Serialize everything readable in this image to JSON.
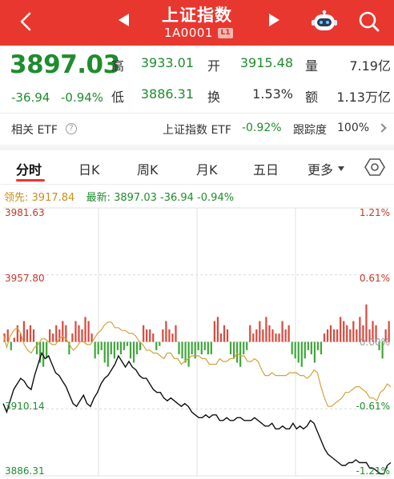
{
  "header": {
    "title": "上证指数",
    "code": "1A0001",
    "level_badge": "L1"
  },
  "quote": {
    "price": "3897.03",
    "change": "-36.94",
    "change_pct": "-0.94%",
    "high_label": "高",
    "high": "3933.01",
    "low_label": "低",
    "low": "3886.31",
    "open_label": "开",
    "open": "3915.48",
    "turnover_label": "换",
    "turnover": "1.53%",
    "volume_label": "量",
    "volume": "7.19亿",
    "amount_label": "额",
    "amount": "1.13万亿"
  },
  "etf": {
    "label": "相关 ETF",
    "name": "上证指数 ETF",
    "change": "-0.92%",
    "tracking_label": "跟踪度",
    "tracking": "100%"
  },
  "tabs": [
    "分时",
    "日K",
    "周K",
    "月K",
    "五日",
    "更多"
  ],
  "legend": {
    "lead_label": "领先:",
    "lead_value": "3917.84",
    "latest_label": "最新:",
    "latest_value": "3897.03",
    "latest_change": "-36.94",
    "latest_pct": "-0.94%"
  },
  "chart_data": {
    "type": "line",
    "left_axis": [
      "3981.63",
      "3957.80",
      "3910.14",
      "3886.31"
    ],
    "right_axis": [
      "1.21%",
      "0.61%",
      "-0.61%",
      "-1.21%"
    ],
    "center_label": "0.00%",
    "ylim": [
      3886.31,
      3981.63
    ],
    "series": [
      {
        "color": "#111111",
        "values": [
          3912,
          3909,
          3913,
          3917,
          3919,
          3921,
          3920,
          3918,
          3917,
          3922,
          3926,
          3930,
          3928,
          3929,
          3926,
          3923,
          3922,
          3920,
          3918,
          3915,
          3912,
          3911,
          3913,
          3915,
          3912,
          3911,
          3914,
          3916,
          3919,
          3921,
          3922,
          3924,
          3926,
          3929,
          3927,
          3925,
          3927,
          3925,
          3924,
          3922,
          3921,
          3921,
          3919,
          3917,
          3916,
          3916,
          3914,
          3913,
          3914,
          3913,
          3912,
          3911,
          3912,
          3911,
          3909,
          3908,
          3907,
          3907,
          3908,
          3907,
          3908,
          3908,
          3906,
          3906,
          3907,
          3906,
          3906,
          3907,
          3907,
          3906,
          3906,
          3906,
          3907,
          3906,
          3905,
          3904,
          3904,
          3905,
          3903,
          3903,
          3904,
          3903,
          3903,
          3905,
          3903,
          3904,
          3903,
          3904,
          3906,
          3905,
          3902,
          3899,
          3896,
          3894,
          3893,
          3892,
          3891,
          3890,
          3890,
          3891,
          3891,
          3892,
          3891,
          3891,
          3891,
          3889,
          3889,
          3888,
          3887,
          3887,
          3890,
          3891
        ]
      },
      {
        "color": "#d4a23a",
        "values": [
          3937,
          3932,
          3936,
          3938,
          3939,
          3937,
          3933,
          3931,
          3930,
          3932,
          3933,
          3935,
          3935,
          3934,
          3933,
          3933,
          3935,
          3936,
          3935,
          3933,
          3931,
          3932,
          3934,
          3934,
          3933,
          3933,
          3935,
          3937,
          3938,
          3940,
          3941,
          3941,
          3939,
          3939,
          3938,
          3938,
          3937,
          3937,
          3936,
          3934,
          3933,
          3931,
          3931,
          3930,
          3930,
          3929,
          3928,
          3930,
          3930,
          3928,
          3928,
          3926,
          3927,
          3928,
          3929,
          3929,
          3929,
          3928,
          3928,
          3926,
          3926,
          3926,
          3928,
          3927,
          3927,
          3928,
          3928,
          3930,
          3929,
          3929,
          3927,
          3927,
          3928,
          3927,
          3924,
          3922,
          3922,
          3923,
          3922,
          3922,
          3922,
          3922,
          3923,
          3923,
          3923,
          3922,
          3922,
          3921,
          3922,
          3924,
          3923,
          3918,
          3914,
          3911,
          3911,
          3912,
          3913,
          3914,
          3916,
          3916,
          3917,
          3918,
          3918,
          3917,
          3916,
          3914,
          3914,
          3913,
          3916,
          3917,
          3919,
          3918
        ]
      }
    ],
    "volume": {
      "description": "red = up, green = down bars around the zero line",
      "values": [
        2,
        3,
        -2,
        1,
        4,
        2,
        5,
        3,
        4,
        3,
        -3,
        -5,
        -6,
        -4,
        3,
        2,
        4,
        3,
        5,
        4,
        -3,
        2,
        5,
        4,
        3,
        6,
        5,
        2,
        -4,
        -3,
        -2,
        -5,
        -6,
        -3,
        -4,
        -2,
        -3,
        -2,
        -1,
        -4,
        -5,
        -3,
        -2,
        4,
        3,
        3,
        2,
        -2,
        -1,
        3,
        5,
        3,
        2,
        4,
        -3,
        -4,
        -5,
        -6,
        -3,
        -4,
        -2,
        -3,
        -2,
        -3,
        -3,
        5,
        6,
        2,
        4,
        3,
        -3,
        -4,
        -5,
        -6,
        -3,
        -2,
        4,
        2,
        3,
        5,
        3,
        6,
        4,
        3,
        2,
        2,
        5,
        3,
        4,
        -3,
        -4,
        -5,
        -6,
        -4,
        -2,
        -3,
        -5,
        -2,
        -3,
        2,
        3,
        4,
        3,
        3,
        6,
        5,
        4,
        3,
        5,
        3,
        6,
        4,
        9,
        3,
        5,
        4,
        -2,
        -4,
        3,
        5
      ]
    }
  }
}
